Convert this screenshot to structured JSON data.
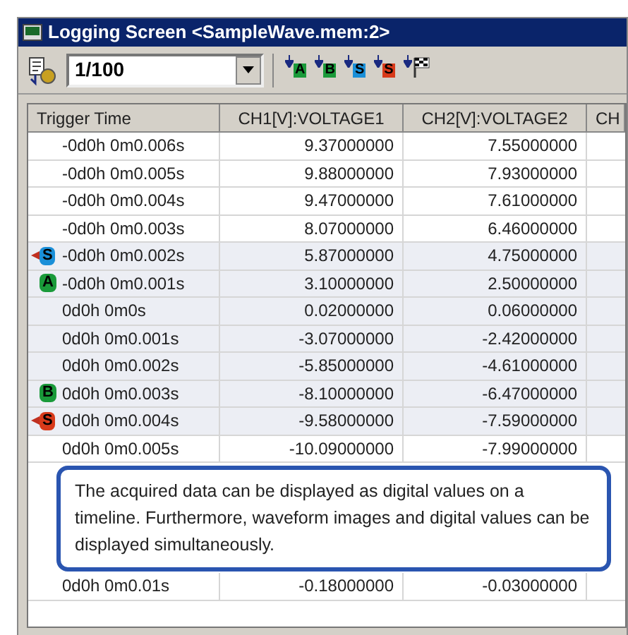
{
  "window": {
    "title": "Logging Screen <SampleWave.mem:2>"
  },
  "toolbar": {
    "ratio": "1/100",
    "markers": [
      {
        "kind": "letter",
        "label": "A",
        "color": "#1a9a3a"
      },
      {
        "kind": "letter",
        "label": "B",
        "color": "#1a9a3a"
      },
      {
        "kind": "letter",
        "label": "S",
        "color": "#1a8fd8"
      },
      {
        "kind": "letter",
        "label": "S",
        "color": "#d83a1a"
      },
      {
        "kind": "flag"
      }
    ]
  },
  "table": {
    "columns": [
      "Trigger Time",
      "CH1[V]:VOLTAGE1",
      "CH2[V]:VOLTAGE2",
      "CH"
    ],
    "rows": [
      {
        "time": "-0d0h 0m0.006s",
        "ch1": "9.37000000",
        "ch2": "7.55000000",
        "highlighted": false
      },
      {
        "time": "-0d0h 0m0.005s",
        "ch1": "9.88000000",
        "ch2": "7.93000000",
        "highlighted": false
      },
      {
        "time": "-0d0h 0m0.004s",
        "ch1": "9.47000000",
        "ch2": "7.61000000",
        "highlighted": false
      },
      {
        "time": "-0d0h 0m0.003s",
        "ch1": "8.07000000",
        "ch2": "6.46000000",
        "highlighted": false
      },
      {
        "time": "-0d0h 0m0.002s",
        "ch1": "5.87000000",
        "ch2": "4.75000000",
        "highlighted": true,
        "marker": {
          "label": "S",
          "color": "#1a8fd8",
          "arrow": true
        }
      },
      {
        "time": "-0d0h 0m0.001s",
        "ch1": "3.10000000",
        "ch2": "2.50000000",
        "highlighted": true,
        "marker": {
          "label": "A",
          "color": "#1a9a3a",
          "arrow": false
        }
      },
      {
        "time": "0d0h 0m0s",
        "ch1": "0.02000000",
        "ch2": "0.06000000",
        "highlighted": true
      },
      {
        "time": "0d0h 0m0.001s",
        "ch1": "-3.07000000",
        "ch2": "-2.42000000",
        "highlighted": true
      },
      {
        "time": "0d0h 0m0.002s",
        "ch1": "-5.85000000",
        "ch2": "-4.61000000",
        "highlighted": true
      },
      {
        "time": "0d0h 0m0.003s",
        "ch1": "-8.10000000",
        "ch2": "-6.47000000",
        "highlighted": true,
        "marker": {
          "label": "B",
          "color": "#1a9a3a",
          "arrow": false
        }
      },
      {
        "time": "0d0h 0m0.004s",
        "ch1": "-9.58000000",
        "ch2": "-7.59000000",
        "highlighted": true,
        "marker": {
          "label": "S",
          "color": "#d83a1a",
          "arrow": true
        }
      },
      {
        "time": "0d0h 0m0.005s",
        "ch1": "-10.09000000",
        "ch2": "-7.99000000",
        "highlighted": false
      }
    ],
    "last_row": {
      "time": "0d0h 0m0.01s",
      "ch1": "-0.18000000",
      "ch2": "-0.03000000",
      "highlighted": false
    }
  },
  "callout": {
    "text": "The acquired data can be displayed as digital values on a timeline. Furthermore, waveform images and digital values can be displayed simultaneously."
  }
}
